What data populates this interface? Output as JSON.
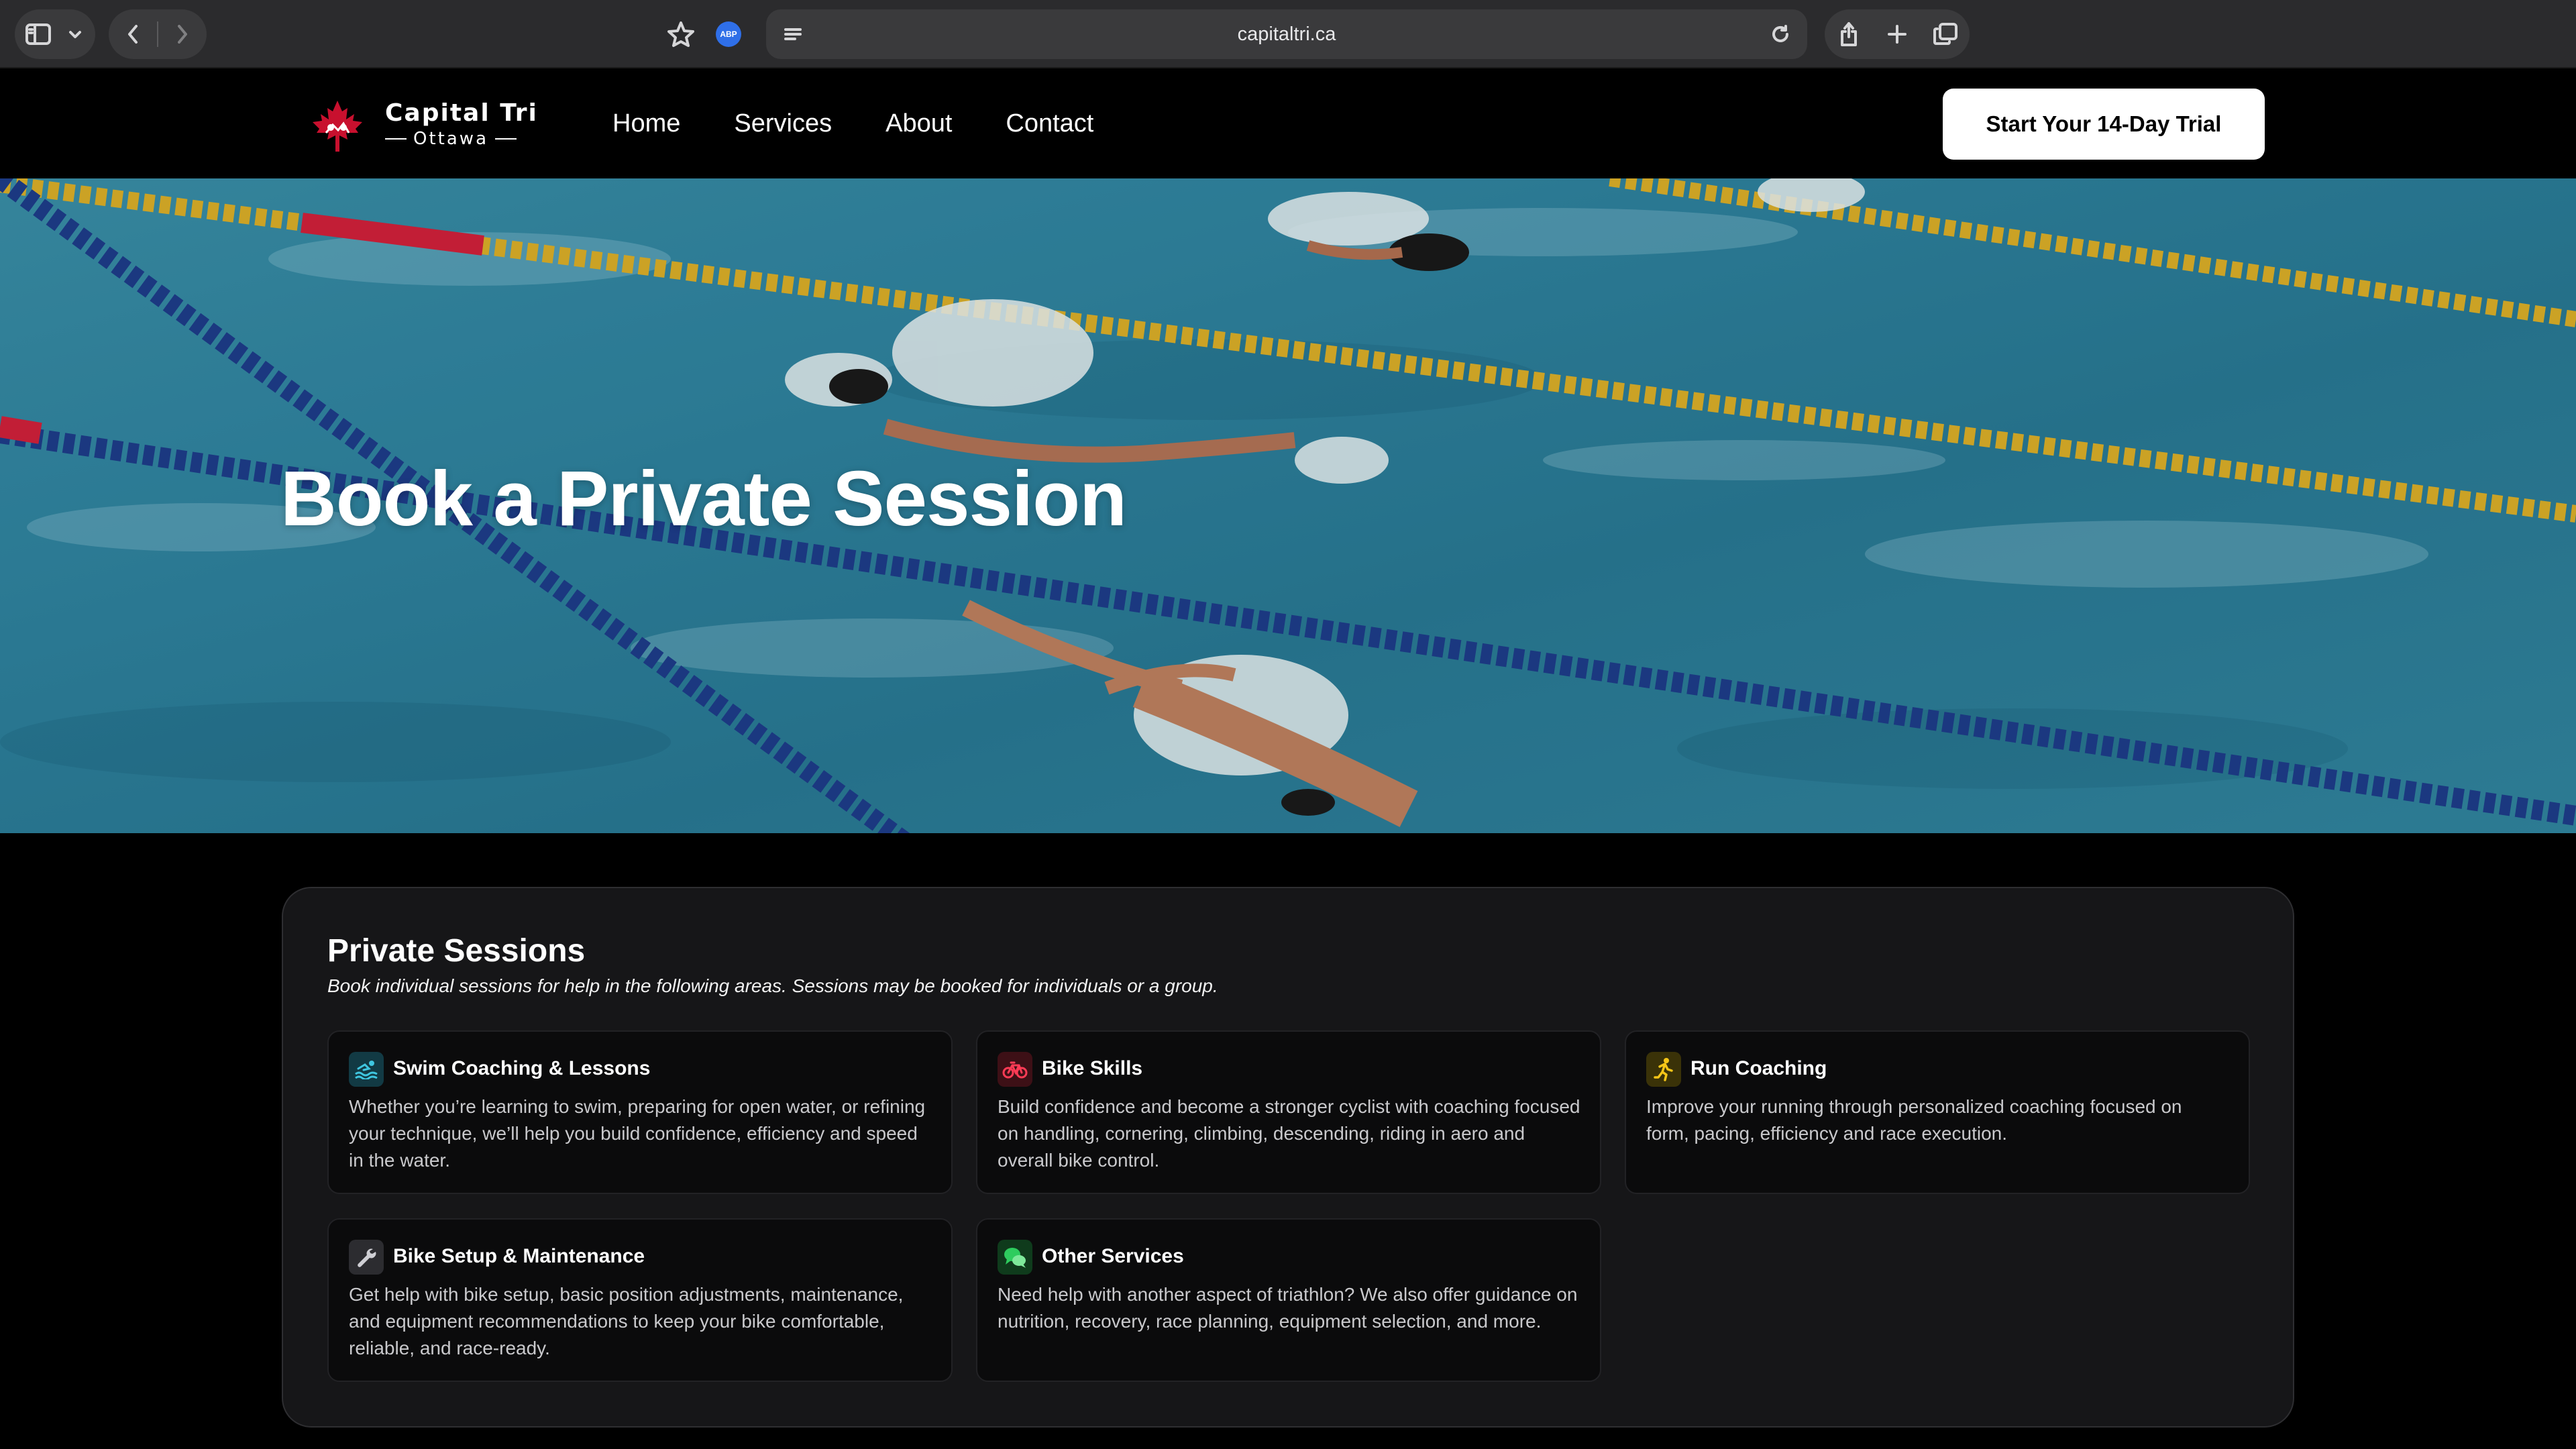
{
  "browser": {
    "url": "capitaltri.ca"
  },
  "header": {
    "logo_name": "Capital Tri",
    "logo_city": "Ottawa",
    "nav": [
      {
        "label": "Home"
      },
      {
        "label": "Services"
      },
      {
        "label": "About"
      },
      {
        "label": "Contact"
      }
    ],
    "cta_label": "Start Your 14-Day Trial"
  },
  "hero": {
    "title": "Book a Private Session"
  },
  "sessions": {
    "title": "Private Sessions",
    "subtitle": "Book individual sessions for help in the following areas. Sessions may be booked for individuals or a group.",
    "cards": [
      {
        "icon": "swimmer-icon",
        "title": "Swim Coaching & Lessons",
        "text": "Whether you’re learning to swim, preparing for open water, or refining your technique, we’ll help you build confidence, efficiency and speed in the water."
      },
      {
        "icon": "bicycle-icon",
        "title": "Bike Skills",
        "text": "Build confidence and become a stronger cyclist with coaching focused on handling, cornering, climbing, descending, riding in aero and overall bike control."
      },
      {
        "icon": "runner-icon",
        "title": "Run Coaching",
        "text": "Improve your running through personalized coaching focused on form, pacing, efficiency and race execution."
      },
      {
        "icon": "wrench-icon",
        "title": "Bike Setup & Maintenance",
        "text": "Get help with bike setup, basic position adjustments, maintenance, and equipment recommendations to keep your bike comfortable, reliable, and race-ready."
      },
      {
        "icon": "chat-bubbles-icon",
        "title": "Other Services",
        "text": "Need help with another aspect of triathlon? We also offer guidance on nutrition, recovery, race planning, equipment selection, and more."
      }
    ]
  },
  "colors": {
    "swim_icon_bg": "#123a44",
    "bike_icon_bg": "#3d1016",
    "run_icon_bg": "#3a3208",
    "wrench_icon_bg": "#2c2c30",
    "chat_icon_bg": "#0f3b1c"
  }
}
